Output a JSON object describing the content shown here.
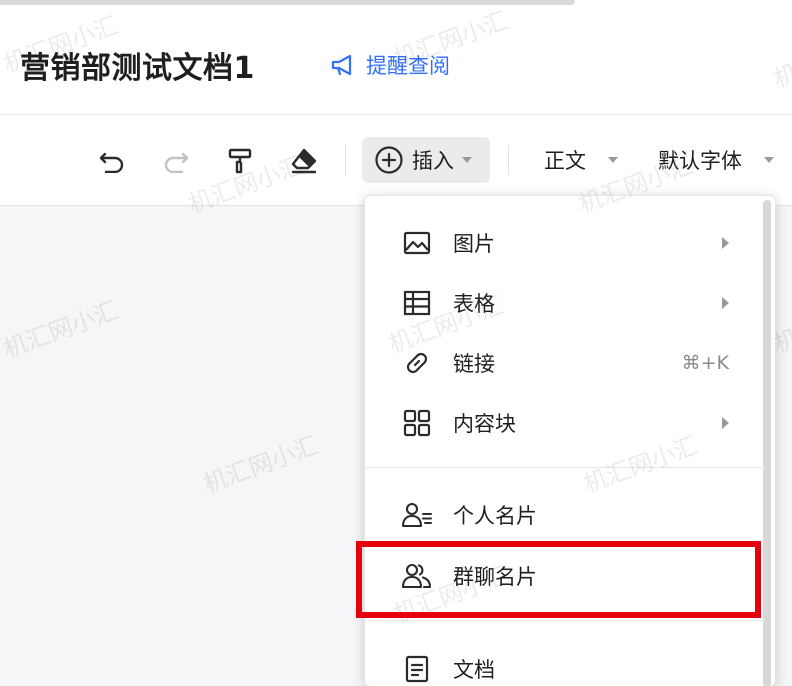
{
  "header": {
    "doc_title": "营销部测试文档1",
    "remind_label": "提醒查阅"
  },
  "toolbar": {
    "insert_label": "插入",
    "text_style_label": "正文",
    "font_label": "默认字体"
  },
  "insert_menu": {
    "items": [
      {
        "label": "图片",
        "icon": "image-icon",
        "submenu": true
      },
      {
        "label": "表格",
        "icon": "table-icon",
        "submenu": true
      },
      {
        "label": "链接",
        "icon": "link-icon",
        "shortcut": "⌘+K"
      },
      {
        "label": "内容块",
        "icon": "content-block-icon",
        "submenu": true
      },
      {
        "label": "个人名片",
        "icon": "personal-card-icon"
      },
      {
        "label": "群聊名片",
        "icon": "group-card-icon",
        "highlighted": true
      },
      {
        "label": "文档",
        "icon": "document-icon"
      }
    ]
  },
  "watermark": "机汇网小汇",
  "colors": {
    "accent": "#3370ff",
    "highlight": "#e6000f"
  }
}
